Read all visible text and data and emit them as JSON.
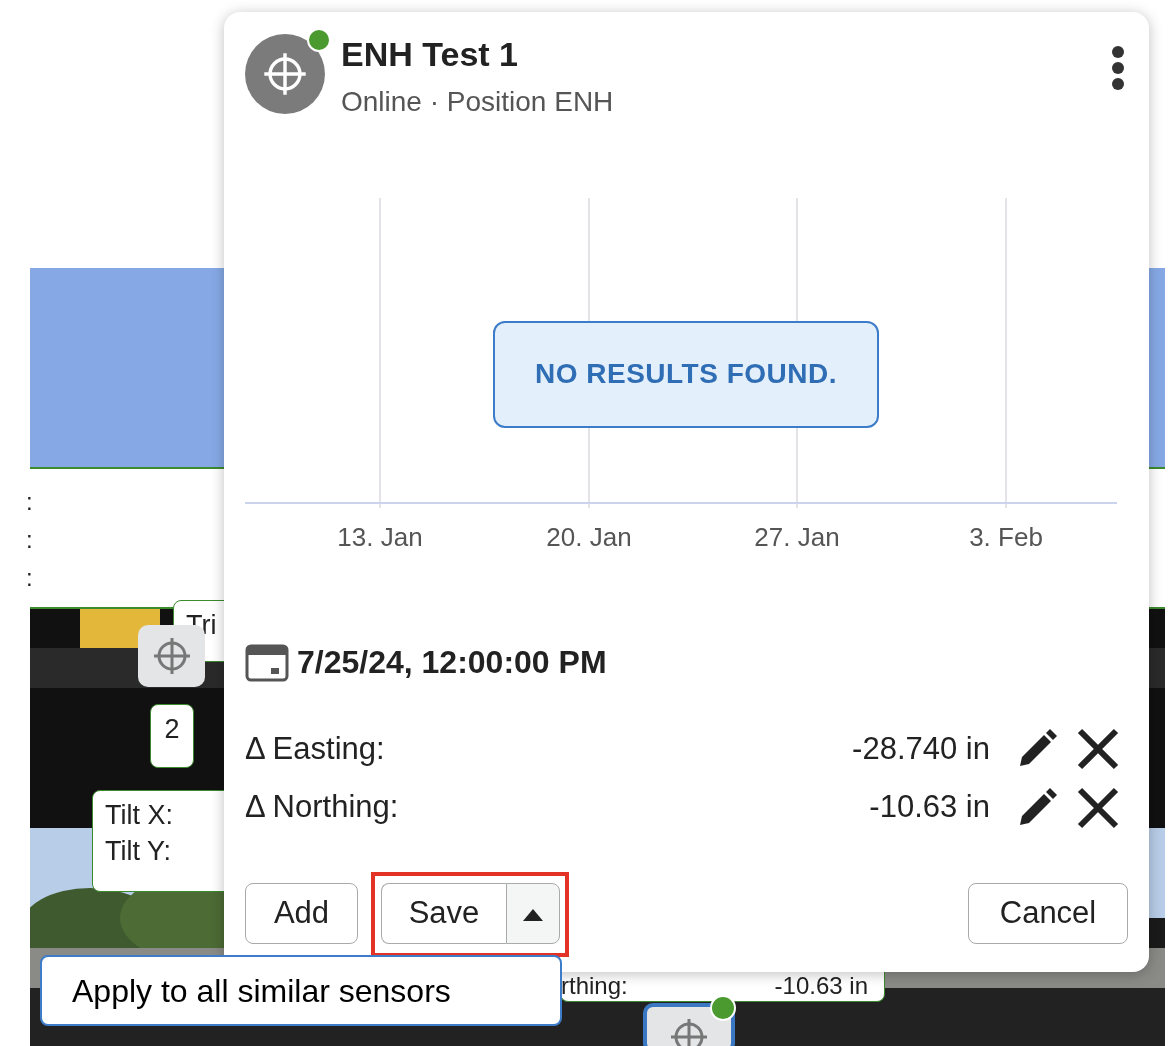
{
  "backdrop": {
    "kind": "picture",
    "labels": [
      {
        "kind": "colons",
        "texts": [
          ":",
          ":",
          ":"
        ]
      },
      {
        "kind": "tip",
        "texts": [
          "Tri"
        ]
      },
      {
        "kind": "count",
        "texts": [
          "2"
        ]
      },
      {
        "kind": "tilt",
        "texts": [
          "Tilt X:",
          "Tilt Y:"
        ]
      },
      {
        "kind": "reading",
        "texts": [
          "rthing:",
          "-10.63 in"
        ]
      }
    ],
    "markers": [
      {
        "kind": "plain",
        "selected": false
      },
      {
        "kind": "bottom",
        "online": true,
        "selected": true
      }
    ]
  },
  "sensor": {
    "title": "ENH Test 1",
    "subtitle": "Online · Position ENH",
    "online": true
  },
  "chart": {
    "x_labels": [
      "13. Jan",
      "20. Jan",
      "27. Jan",
      "3. Feb"
    ],
    "message": "NO RESULTS FOUND."
  },
  "timestamp": "7/25/24, 12:00:00 PM",
  "rows": [
    {
      "label": "Δ Easting:",
      "value": "-28.740 in"
    },
    {
      "label": "Δ Northing:",
      "value": "-10.63 in"
    }
  ],
  "buttons": {
    "add": "Add",
    "save": "Save",
    "cancel": "Cancel",
    "save_menu_open": true
  },
  "save_menu": [
    "Apply to all similar sensors"
  ]
}
